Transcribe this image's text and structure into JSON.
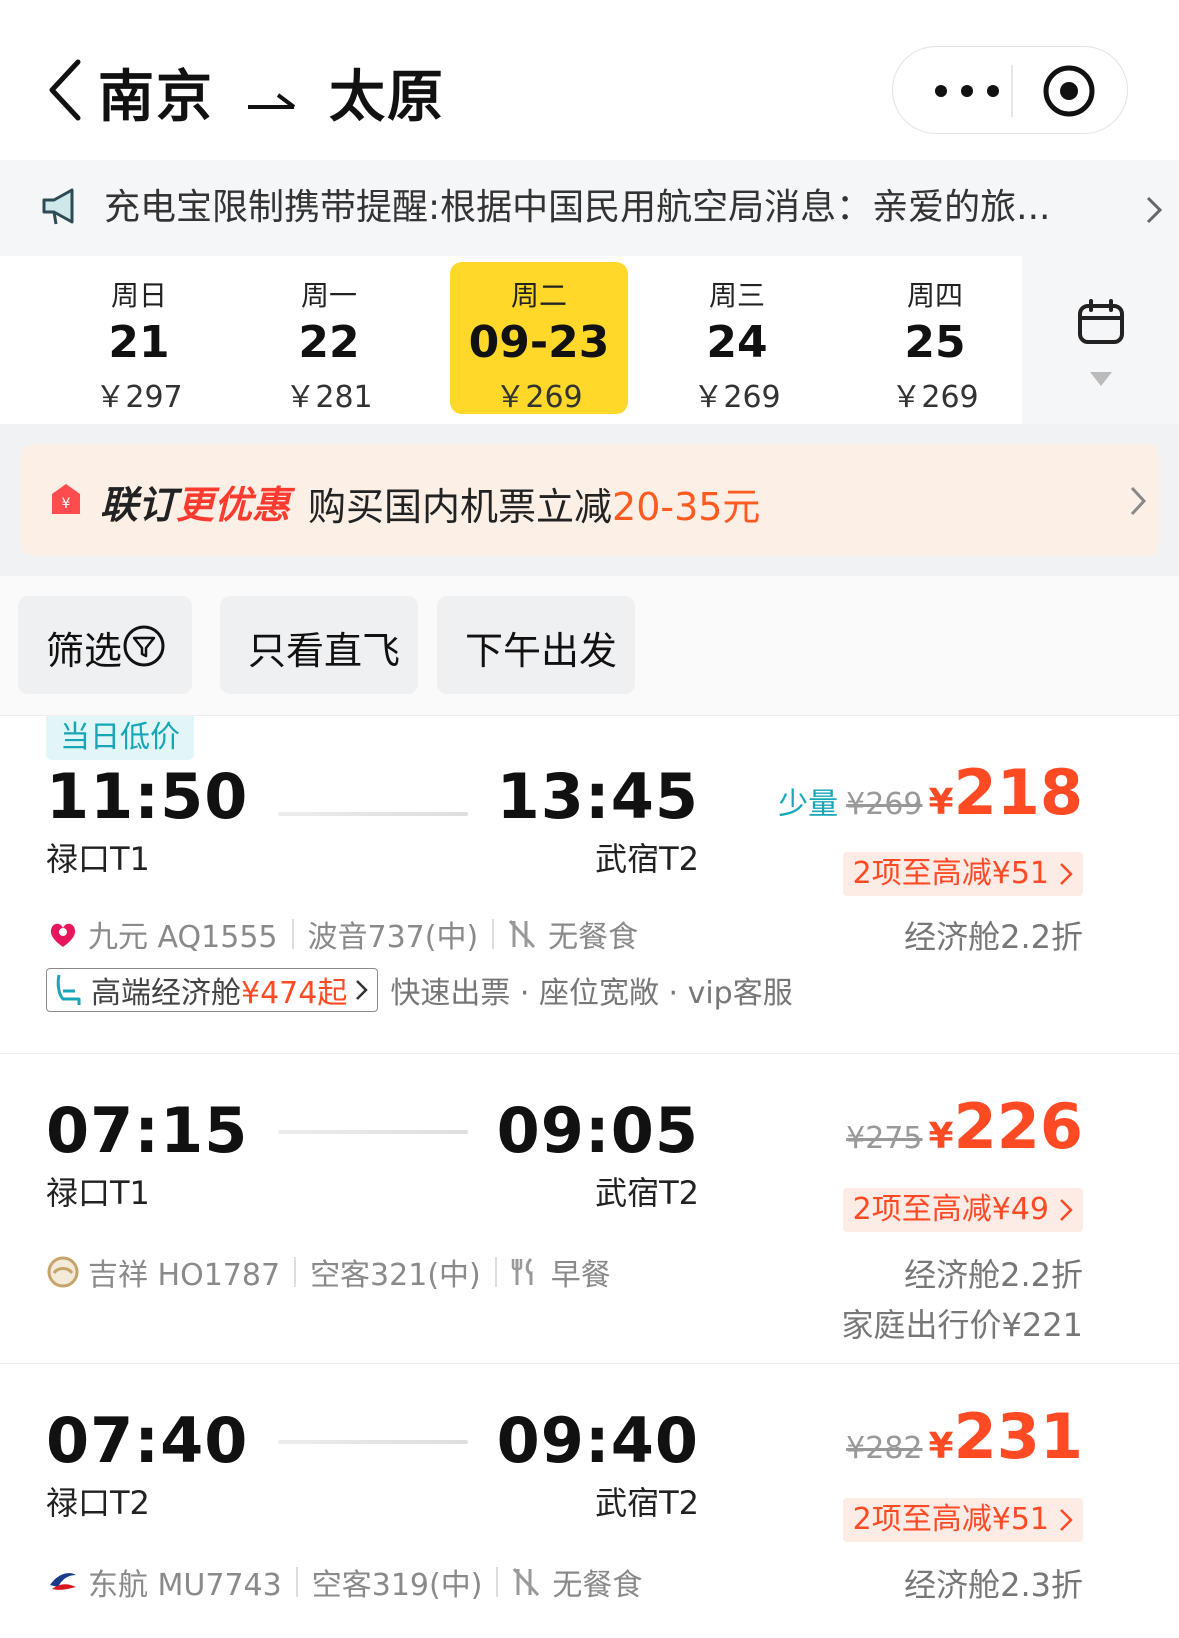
{
  "header": {
    "origin": "南京",
    "destination": "太原"
  },
  "notice": {
    "text": "充电宝限制携带提醒:根据中国民用航空局消息：亲爱的旅..."
  },
  "dates": [
    {
      "weekday": "周日",
      "day": "21",
      "price": "￥297",
      "active": false
    },
    {
      "weekday": "周一",
      "day": "22",
      "price": "￥281",
      "active": false
    },
    {
      "weekday": "周二",
      "day": "09-23",
      "price": "￥269",
      "active": true
    },
    {
      "weekday": "周三",
      "day": "24",
      "price": "￥269",
      "active": false
    },
    {
      "weekday": "周四",
      "day": "25",
      "price": "￥269",
      "active": false
    }
  ],
  "promo": {
    "brand_a": "联订",
    "brand_b": "更优惠",
    "desc": "购买国内机票立减",
    "amount": "20-35元"
  },
  "filters": {
    "filter": "筛选",
    "direct": "只看直飞",
    "afternoon": "下午出发"
  },
  "flights": [
    {
      "tag": "当日低价",
      "dep_time": "11:50",
      "dep_term": "禄口T1",
      "arr_time": "13:45",
      "arr_term": "武宿T2",
      "few": "少量",
      "old_price": "¥269",
      "yen": "¥",
      "price": "218",
      "discount": "2项至高减¥51",
      "airline": "九元 AQ1555",
      "aircraft": "波音737(中)",
      "meal": "无餐食",
      "cabin": "经济舱2.2折",
      "upsell_text": "高端经济舱",
      "upsell_amount": "¥474起",
      "perks": "快速出票 · 座位宽敞 · vip客服"
    },
    {
      "dep_time": "07:15",
      "dep_term": "禄口T1",
      "arr_time": "09:05",
      "arr_term": "武宿T2",
      "old_price": "¥275",
      "yen": "¥",
      "price": "226",
      "discount": "2项至高减¥49",
      "airline": "吉祥 HO1787",
      "aircraft": "空客321(中)",
      "meal": "早餐",
      "cabin": "经济舱2.2折",
      "family": "家庭出行价¥221"
    },
    {
      "dep_time": "07:40",
      "dep_term": "禄口T2",
      "arr_time": "09:40",
      "arr_term": "武宿T2",
      "old_price": "¥282",
      "yen": "¥",
      "price": "231",
      "discount": "2项至高减¥51",
      "airline": "东航 MU7743",
      "aircraft": "空客319(中)",
      "meal": "无餐食",
      "cabin": "经济舱2.3折"
    }
  ]
}
